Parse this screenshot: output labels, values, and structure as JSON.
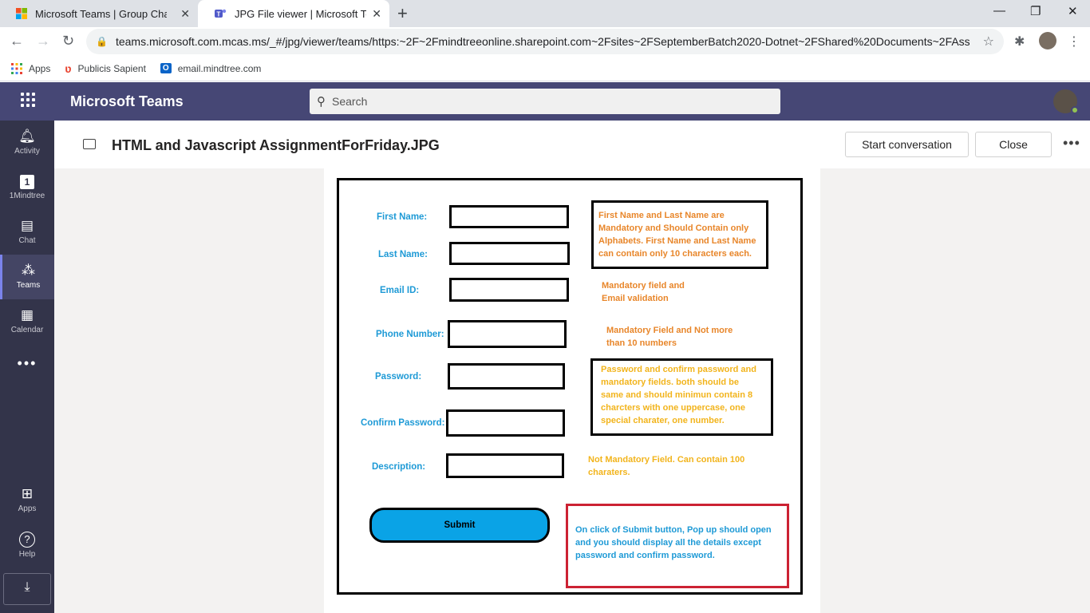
{
  "browser": {
    "tabs": [
      {
        "title": "Microsoft Teams | Group Chat So",
        "active": false
      },
      {
        "title": "JPG File viewer | Microsoft Teams",
        "active": true
      }
    ],
    "url": "teams.microsoft.com.mcas.ms/_#/jpg/viewer/teams/https:~2F~2Fmindtreeonline.sharepoint.com~2Fsites~2FSeptemberBatch2020-Dotnet~2FShared%20Documents~2FAssi...",
    "bookmarks": [
      {
        "label": "Apps",
        "icon": "apps-grid-icon"
      },
      {
        "label": "Publicis Sapient",
        "icon": "publicis-sapient-icon"
      },
      {
        "label": "email.mindtree.com",
        "icon": "outlook-icon"
      }
    ]
  },
  "teams": {
    "brand": "Microsoft Teams",
    "search_placeholder": "Search",
    "rail": [
      {
        "label": "Activity",
        "icon": "bell-icon"
      },
      {
        "label": "1Mindtree",
        "icon": "mindtree-app-icon"
      },
      {
        "label": "Chat",
        "icon": "chat-icon"
      },
      {
        "label": "Teams",
        "icon": "teams-icon",
        "active": true
      },
      {
        "label": "Calendar",
        "icon": "calendar-icon"
      },
      {
        "label": "Apps",
        "icon": "apps-icon"
      },
      {
        "label": "Help",
        "icon": "help-icon"
      }
    ]
  },
  "viewer": {
    "filename": "HTML and Javascript AssignmentForFriday.JPG",
    "start_conversation": "Start conversation",
    "close": "Close"
  },
  "assignment": {
    "fields": [
      "First Name:",
      "Last Name:",
      "Email ID:",
      "Phone Number:",
      "Password:",
      "Confirm Password:",
      "Description:"
    ],
    "notes": {
      "names": [
        "First Name and Last Name are",
        "Mandatory and Should Contain only",
        "Alphabets. First Name and Last Name",
        "can contain only 10 characters each."
      ],
      "email": [
        "Mandatory field and",
        "Email validation"
      ],
      "phone": [
        "Mandatory Field and Not more",
        "than 10 numbers"
      ],
      "password": [
        "Password and confirm password and",
        "mandatory fields. both should be",
        "same and should minimun contain 8",
        "charcters with one uppercase, one",
        "special charater, one number."
      ],
      "description": [
        "Not Mandatory Field. Can contain 100",
        "charaters."
      ],
      "submit": [
        "On click of Submit button, Pop up should open",
        "and you should display all the details except",
        "password and confirm password."
      ]
    },
    "submit_label": "Submit"
  }
}
